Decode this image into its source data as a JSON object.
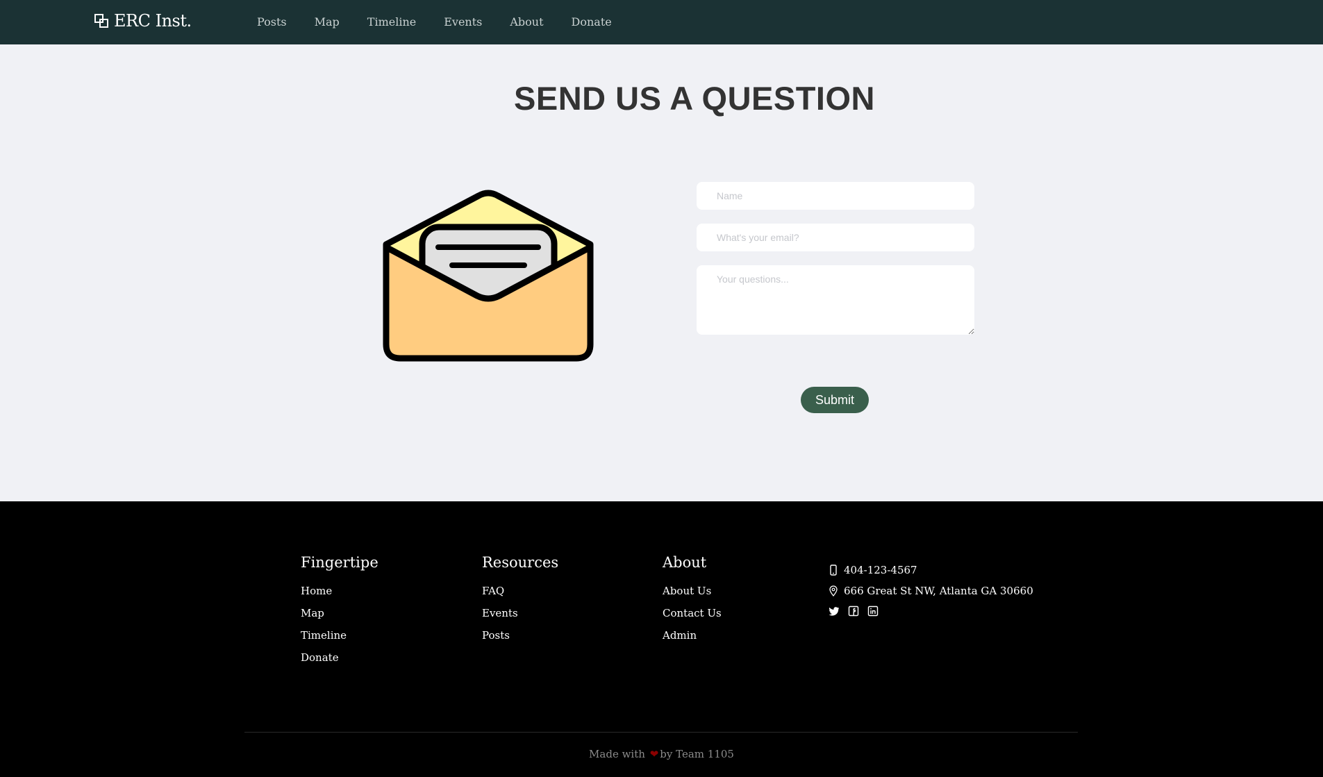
{
  "nav": {
    "brand": "ERC Inst.",
    "links": [
      "Posts",
      "Map",
      "Timeline",
      "Events",
      "About",
      "Donate"
    ]
  },
  "main": {
    "heading": "SEND US A QUESTION",
    "form": {
      "name_placeholder": "Name",
      "email_placeholder": "What's your email?",
      "questions_placeholder": "Your questions...",
      "submit_label": "Submit"
    }
  },
  "footer": {
    "columns": [
      {
        "title": "Fingertipe",
        "links": [
          "Home",
          "Map",
          "Timeline",
          "Donate"
        ]
      },
      {
        "title": "Resources",
        "links": [
          "FAQ",
          "Events",
          "Posts"
        ]
      },
      {
        "title": "About",
        "links": [
          "About Us",
          "Contact Us",
          "Admin"
        ]
      }
    ],
    "phone": "404-123-4567",
    "address": "666 Great St NW, Atlanta GA 30660",
    "social": [
      "twitter-icon",
      "facebook-icon",
      "linkedin-icon"
    ],
    "credit_prefix": "Made with",
    "credit_suffix": "by Team 1105"
  },
  "colors": {
    "nav_bg": "#1b3234",
    "page_bg": "#f0f1f5",
    "footer_bg": "#000000",
    "submit_bg": "#3a5f4c",
    "envelope_body": "#ffcc80",
    "envelope_flap": "#fff59d",
    "letter": "#e0e0e0"
  }
}
